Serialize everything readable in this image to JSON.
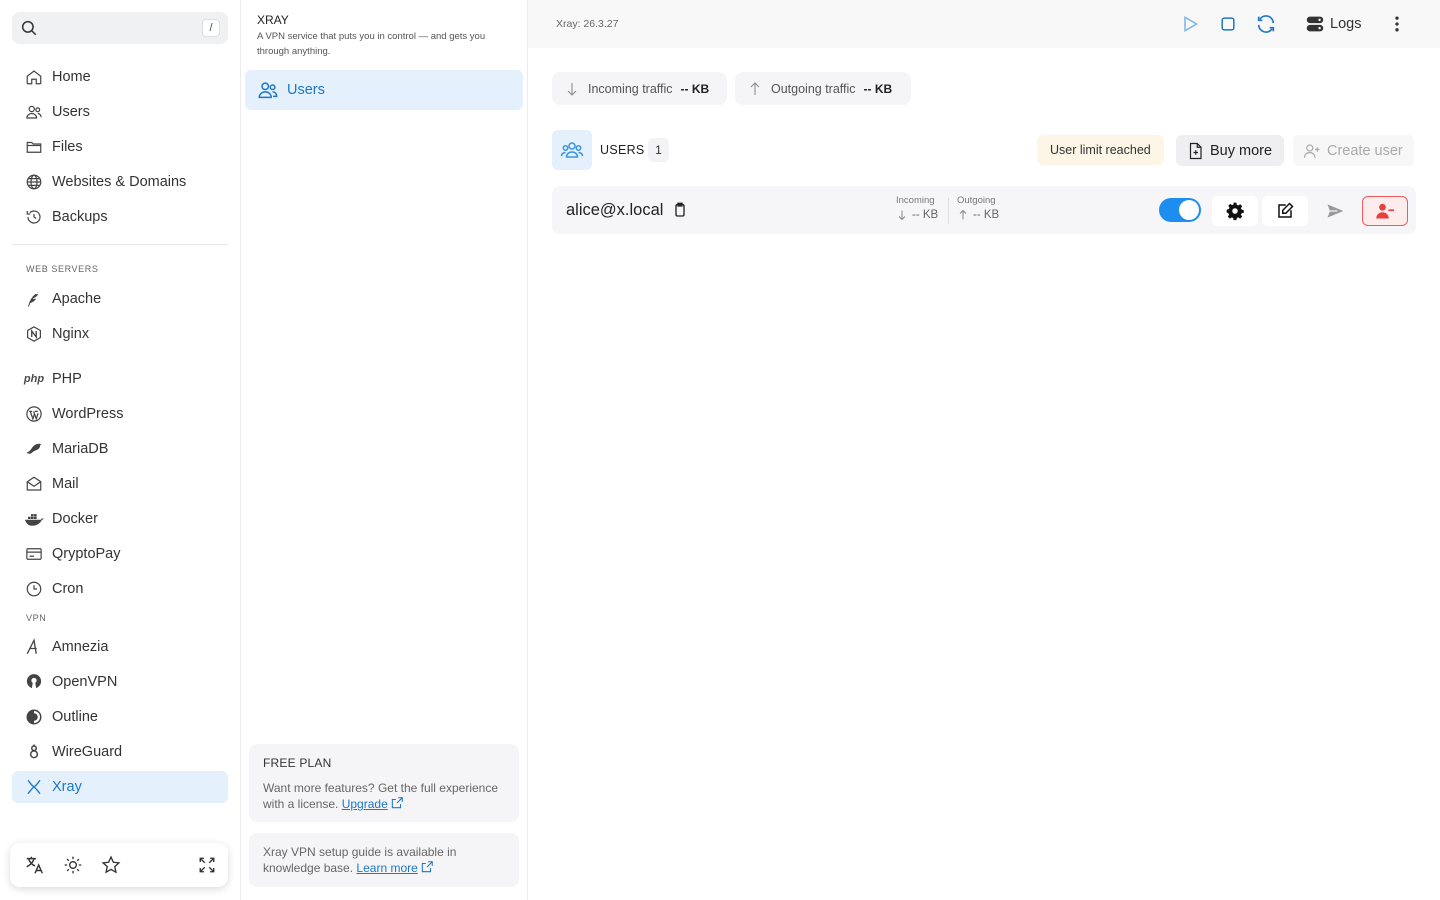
{
  "nav": {
    "search_shortcut": "/",
    "items": [
      {
        "label": "Home",
        "icon": "home-icon"
      },
      {
        "label": "Users",
        "icon": "users-icon"
      },
      {
        "label": "Files",
        "icon": "folder-icon"
      },
      {
        "label": "Websites & Domains",
        "icon": "globe-icon"
      },
      {
        "label": "Backups",
        "icon": "history-icon"
      }
    ],
    "section_web": "WEB SERVERS",
    "web_items": [
      {
        "label": "Apache",
        "icon": "feather-icon"
      },
      {
        "label": "Nginx",
        "icon": "nginx-icon"
      }
    ],
    "other_items": [
      {
        "label": "PHP",
        "icon": "php-icon",
        "icon_text": "php"
      },
      {
        "label": "WordPress",
        "icon": "wordpress-icon"
      },
      {
        "label": "MariaDB",
        "icon": "seal-icon"
      },
      {
        "label": "Mail",
        "icon": "mail-icon"
      },
      {
        "label": "Docker",
        "icon": "docker-icon"
      },
      {
        "label": "QryptoPay",
        "icon": "card-icon"
      },
      {
        "label": "Cron",
        "icon": "clock-icon"
      }
    ],
    "section_vpn": "VPN",
    "vpn_items": [
      {
        "label": "Amnezia",
        "icon": "amnezia-icon"
      },
      {
        "label": "OpenVPN",
        "icon": "openvpn-icon"
      },
      {
        "label": "Outline",
        "icon": "outline-icon"
      },
      {
        "label": "WireGuard",
        "icon": "wireguard-icon"
      },
      {
        "label": "Xray",
        "icon": "xray-icon",
        "active": true
      }
    ]
  },
  "mid": {
    "title": "XRAY",
    "description": "A VPN service that puts you in control — and gets you through anything.",
    "item_label": "Users",
    "plan_title": "FREE PLAN",
    "plan_text": "Want more features? Get the full experience with a license.",
    "plan_link": "Upgrade",
    "guide_text": "Xray VPN setup guide is available in knowledge base.",
    "guide_link": "Learn more"
  },
  "header": {
    "version": "Xray: 26.3.27",
    "logs_label": "Logs"
  },
  "traffic": {
    "incoming_label": "Incoming traffic",
    "incoming_value": "-- KB",
    "outgoing_label": "Outgoing traffic",
    "outgoing_value": "-- KB"
  },
  "users": {
    "label": "USERS",
    "count": "1",
    "limit_label": "User limit reached",
    "buy_label": "Buy more",
    "create_label": "Create user",
    "rows": [
      {
        "email": "alice@x.local",
        "incoming_label": "Incoming",
        "incoming_value": "-- KB",
        "outgoing_label": "Outgoing",
        "outgoing_value": "-- KB",
        "enabled": true
      }
    ]
  },
  "colors": {
    "accent": "#1d77c9",
    "toggle": "#1d8ef0",
    "danger": "#f05a5a"
  }
}
